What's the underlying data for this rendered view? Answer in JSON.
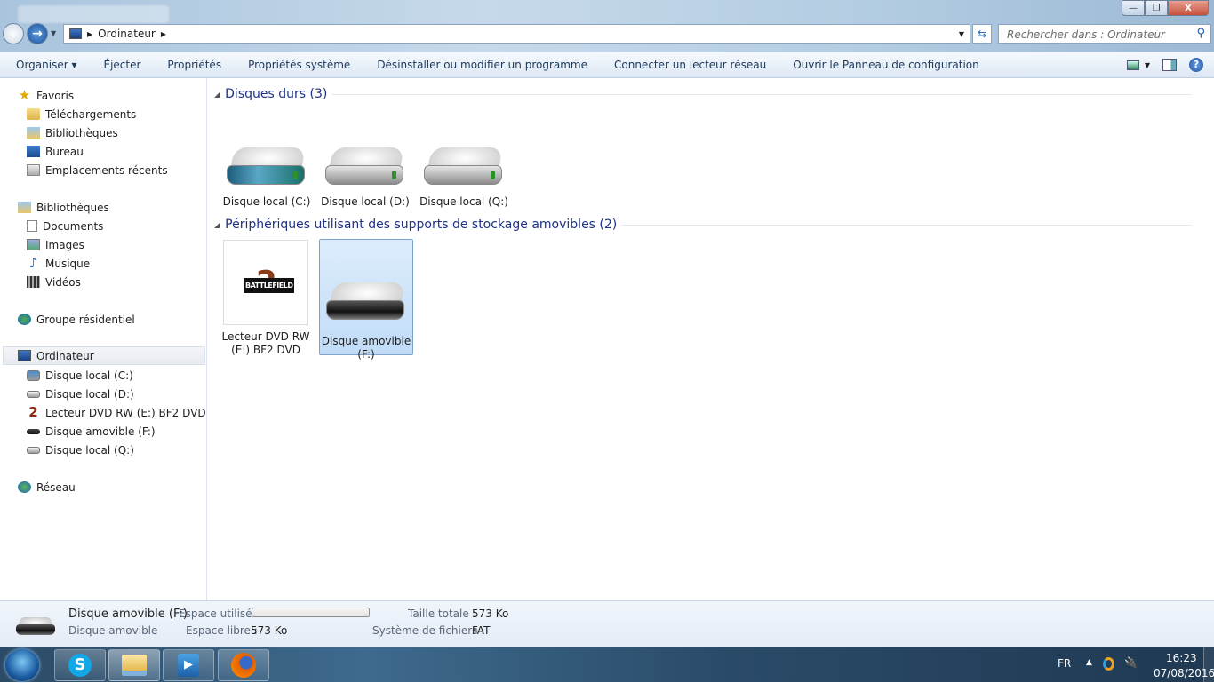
{
  "window": {
    "address_path": [
      "Ordinateur"
    ],
    "search_placeholder": "Rechercher dans : Ordinateur",
    "buttons": {
      "minimize": "—",
      "maximize": "❐",
      "close": "X"
    }
  },
  "toolbar": {
    "items": [
      "Organiser",
      "Éjecter",
      "Propriétés",
      "Propriétés système",
      "Désinstaller ou modifier un programme",
      "Connecter un lecteur réseau",
      "Ouvrir le Panneau de configuration"
    ]
  },
  "sidebar": {
    "favorites": {
      "label": "Favoris",
      "items": [
        "Téléchargements",
        "Bibliothèques",
        "Bureau",
        "Emplacements récents"
      ]
    },
    "libraries": {
      "label": "Bibliothèques",
      "items": [
        "Documents",
        "Images",
        "Musique",
        "Vidéos"
      ]
    },
    "homegroup": {
      "label": "Groupe résidentiel"
    },
    "computer": {
      "label": "Ordinateur",
      "items": [
        "Disque local (C:)",
        "Disque local (D:)",
        "Lecteur DVD RW (E:) BF2 DVD",
        "Disque amovible (F:)",
        "Disque local (Q:)"
      ]
    },
    "network": {
      "label": "Réseau"
    }
  },
  "content": {
    "hard_drives": {
      "header": "Disques durs (3)",
      "items": [
        "Disque local (C:)",
        "Disque local (D:)",
        "Disque local (Q:)"
      ]
    },
    "removable": {
      "header": "Périphériques utilisant des supports de stockage amovibles (2)",
      "items": [
        {
          "line1": "Lecteur DVD RW",
          "line2": "(E:) BF2 DVD",
          "logo_text": "BATTLEFIELD 2"
        },
        {
          "line1": "Disque amovible",
          "line2": "(F:)"
        }
      ]
    }
  },
  "details": {
    "name": "Disque amovible (F:)",
    "type": "Disque amovible",
    "used_label": "Espace utilisé :",
    "used_fraction": 0,
    "free_label": "Espace libre :",
    "free_value": "573 Ko",
    "total_label": "Taille totale :",
    "total_value": "573 Ko",
    "fs_label": "Système de fichiers :",
    "fs_value": "FAT"
  },
  "taskbar": {
    "skype_letter": "S",
    "language": "FR",
    "time": "16:23",
    "date": "07/08/2016"
  }
}
